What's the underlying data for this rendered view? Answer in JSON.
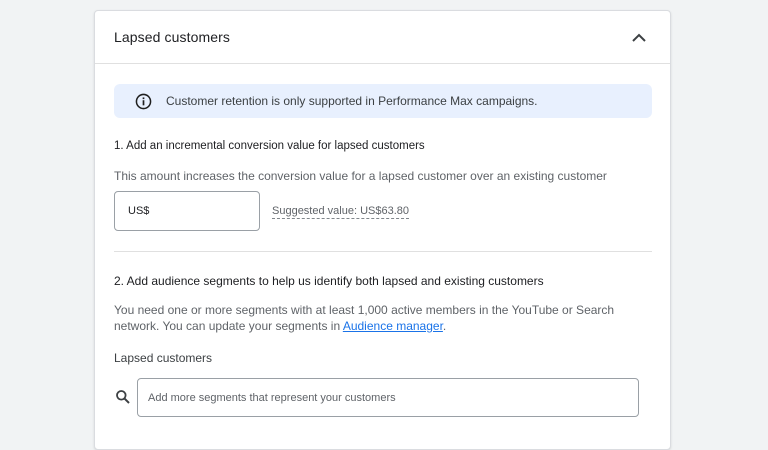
{
  "card": {
    "title": "Lapsed customers"
  },
  "banner": {
    "text": "Customer retention is only supported in Performance Max campaigns."
  },
  "section1": {
    "heading": "1. Add an incremental conversion value for lapsed customers",
    "description": "This amount increases the conversion value for a lapsed customer over an existing customer",
    "currency_prefix": "US$",
    "suggested_value": "Suggested value: US$63.80"
  },
  "section2": {
    "heading": "2. Add audience segments to help us identify both lapsed and existing customers",
    "description_line1": "You need one or more segments with at least 1,000 active members in the YouTube or Search",
    "description_line2_prefix": "network. You can update your segments in ",
    "link_text": "Audience manager",
    "description_line2_suffix": ".",
    "field_label": "Lapsed customers",
    "search_placeholder": "Add more segments that represent your customers"
  },
  "colors": {
    "banner_bg": "#e8f0fe",
    "link": "#1a73e8",
    "info_icon": "#1f1f1f"
  },
  "icons": {
    "collapse": "chevron-up-icon",
    "info": "info-icon",
    "search": "search-icon"
  }
}
